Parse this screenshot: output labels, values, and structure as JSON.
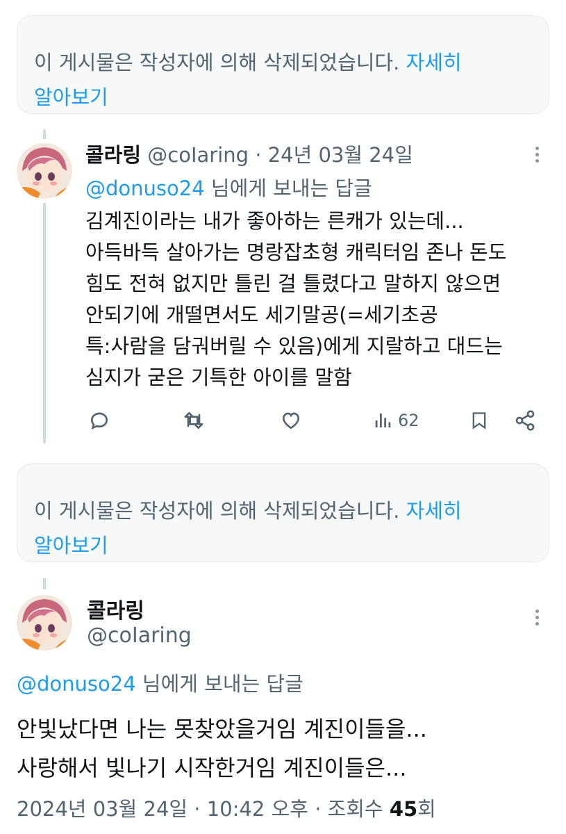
{
  "deleted_notice": {
    "text": "이 게시물은 작성자에 의해 삭제되었습니다.",
    "link": "자세히",
    "link2": "알아보기"
  },
  "reply_post": {
    "display_name": "콜라링",
    "handle": "@coIaring",
    "separator": "·",
    "date": "24년 03월 24일",
    "reply_mention": "@donuso24",
    "reply_suffix": " 님에게 보내는 답글",
    "body": "김계진이라는 내가 좋아하는 른캐가 있는데...\n아득바득 살아가는 명랑잡초형 캐릭터임 존나 돈도\n힘도 전혀 없지만 틀린 걸 틀렸다고 말하지 않으면\n안되기에 개떨면서도 세기말공(=세기초공\n특:사람을 담궈버릴 수 있음)에게 지랄하고 대드는\n심지가 굳은 기특한 아이를 말함",
    "view_count": "62"
  },
  "main_post": {
    "display_name": "콜라링",
    "handle": "@coIaring",
    "reply_mention": "@donuso24",
    "reply_suffix": " 님에게 보내는 답글",
    "body": "안빛났다면 나는 못찾았을거임 계진이들을...\n사랑해서 빛나기 시작한거임 계진이들은...",
    "timestamp": "2024년 03월 24일 · 10:42 오후 · 조회수 ",
    "views": "45",
    "views_suffix": "회"
  },
  "icons": [
    "reply-icon",
    "retweet-icon",
    "like-icon",
    "views-icon",
    "bookmark-icon",
    "share-icon",
    "more-icon",
    "avatar"
  ],
  "colors": {
    "link": "#1d9bf0",
    "muted": "#536471",
    "text": "#0f1419",
    "notice_bg": "#f7f9f9"
  }
}
